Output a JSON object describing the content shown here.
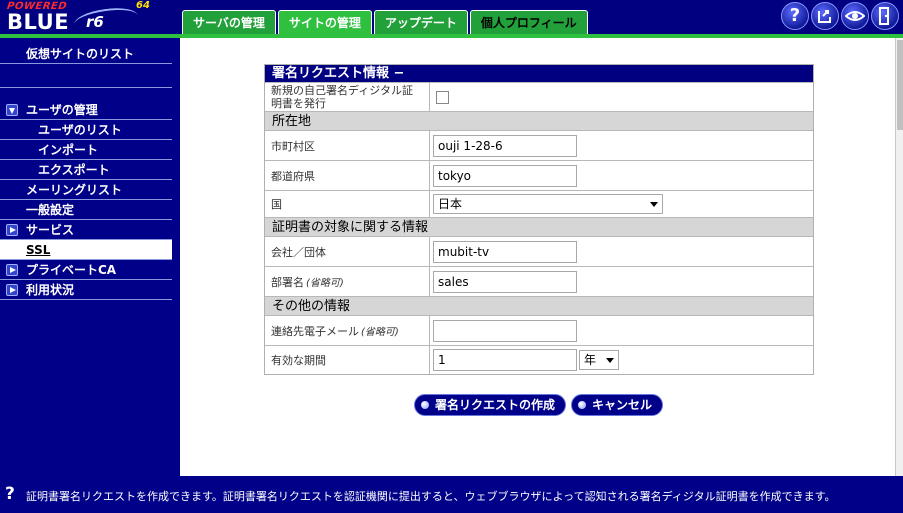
{
  "logo": {
    "powered": "POWERED",
    "blue": "BLUE",
    "r6": "r6",
    "version": "64"
  },
  "tabs": [
    {
      "label": "サーバの管理"
    },
    {
      "label": "サイトの管理"
    },
    {
      "label": "アップデート"
    },
    {
      "label": "個人プロフィール"
    }
  ],
  "header_icons": [
    "help-icon",
    "upload-icon",
    "eye-icon",
    "logout-icon"
  ],
  "sidebar": {
    "items": [
      {
        "label": "仮想サイトのリスト"
      },
      {
        "label": ""
      },
      {
        "label": "ユーザの管理"
      },
      {
        "label": "ユーザのリスト"
      },
      {
        "label": "インポート"
      },
      {
        "label": "エクスポート"
      },
      {
        "label": "メーリングリスト"
      },
      {
        "label": "一般設定"
      },
      {
        "label": "サービス"
      },
      {
        "label": "SSL"
      },
      {
        "label": "プライベートCA"
      },
      {
        "label": "利用状況"
      }
    ]
  },
  "form": {
    "title": "署名リクエスト情報 −",
    "self_signed_label": "新規の自己署名ディジタル証明書を発行",
    "self_signed_checked": false,
    "sec_location": "所在地",
    "city_label": "市町村区",
    "city_value": "ouji 1-28-6",
    "state_label": "都道府県",
    "state_value": "tokyo",
    "country_label": "国",
    "country_value": "日本",
    "sec_subject": "証明書の対象に関する情報",
    "company_label": "会社／団体",
    "company_value": "mubit-tv",
    "dept_label": "部署名",
    "dept_optional": "(省略可)",
    "dept_value": "sales",
    "sec_other": "その他の情報",
    "email_label": "連絡先電子メール",
    "email_optional": "(省略可)",
    "email_value": "",
    "period_label": "有効な期間",
    "period_value": "1",
    "period_unit": "年"
  },
  "buttons": {
    "create": "署名リクエストの作成",
    "cancel": "キャンセル"
  },
  "footer": {
    "help": "証明書署名リクエストを作成できます。証明書署名リクエストを認証機関に提出すると、ウェブブラウザによって認知される署名ディジタル証明書を作成できます。"
  },
  "colors": {
    "navy": "#000088",
    "tab_green": "#30c040",
    "section_gray": "#d6d6d6"
  }
}
